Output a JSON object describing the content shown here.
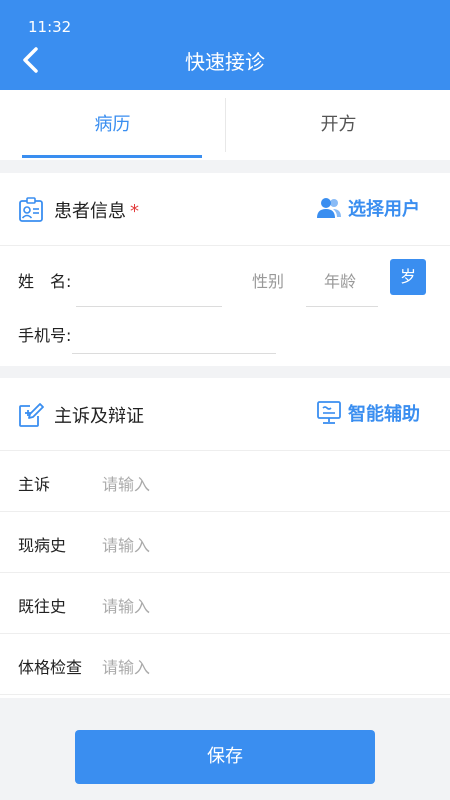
{
  "status": {
    "time": "11:32"
  },
  "header": {
    "title": "快速接诊",
    "back_icon": "chevron-left-icon"
  },
  "tabs": [
    {
      "label": "病历",
      "active": true
    },
    {
      "label": "开方",
      "active": false
    }
  ],
  "patient_info": {
    "title": "患者信息",
    "required_mark": "*",
    "action_label": "选择用户",
    "action_icon": "users-icon",
    "section_icon": "id-card-icon",
    "name_label": "姓　名:",
    "gender_placeholder": "性别",
    "age_placeholder": "年龄",
    "age_unit": "岁",
    "phone_label": "手机号:"
  },
  "complaint": {
    "title": "主诉及辩证",
    "section_icon": "edit-plus-icon",
    "action_label": "智能辅助",
    "action_icon": "assistant-screen-icon",
    "rows": [
      {
        "label": "主诉",
        "placeholder": "请输入"
      },
      {
        "label": "现病史",
        "placeholder": "请输入"
      },
      {
        "label": "既往史",
        "placeholder": "请输入"
      },
      {
        "label": "体格检查",
        "placeholder": "请输入"
      }
    ]
  },
  "footer": {
    "save_label": "保存"
  },
  "colors": {
    "primary": "#3a8ef0",
    "required": "#e23b3b",
    "background": "#f2f3f5"
  }
}
